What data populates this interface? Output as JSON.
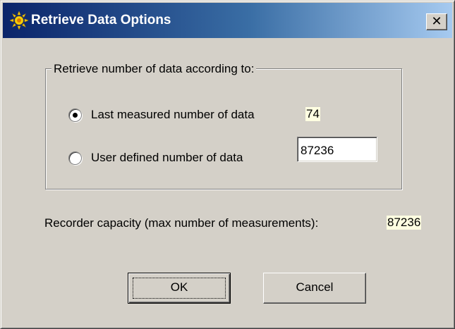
{
  "window": {
    "title": "Retrieve Data Options",
    "title_icon": "sun-gear-icon",
    "close_label": "✕"
  },
  "group": {
    "legend": "Retrieve number of data according to:",
    "options": [
      {
        "label": "Last measured number of data",
        "value": "74",
        "selected": true
      },
      {
        "label": "User defined number of data",
        "input_value": "87236",
        "selected": false
      }
    ]
  },
  "capacity": {
    "label": "Recorder capacity (max number of measurements):",
    "value": "87236"
  },
  "buttons": {
    "ok_label": "OK",
    "cancel_label": "Cancel"
  },
  "colors": {
    "title_gradient_start": "#0a246a",
    "title_gradient_end": "#a6caf0",
    "dialog_face": "#d4d0c8",
    "value_highlight": "#ffffe1"
  }
}
